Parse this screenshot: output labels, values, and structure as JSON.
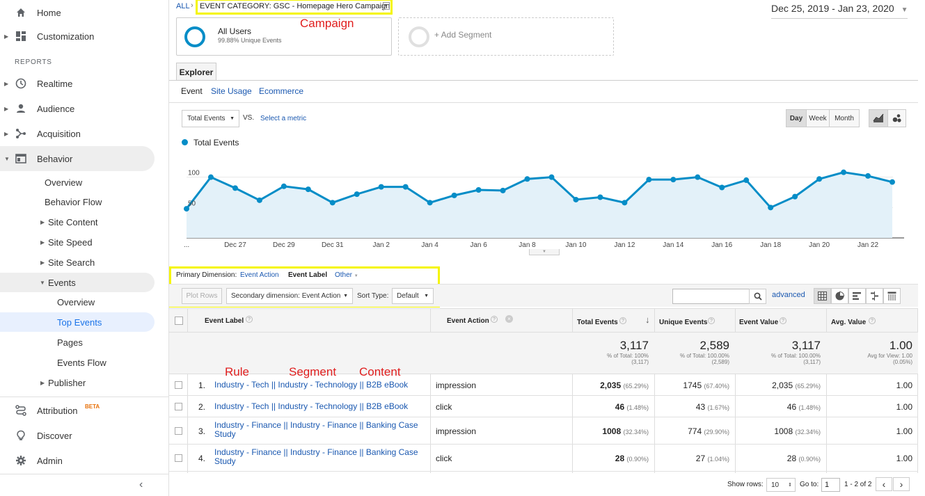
{
  "sidebar": {
    "home": "Home",
    "customization": "Customization",
    "reports_header": "REPORTS",
    "realtime": "Realtime",
    "audience": "Audience",
    "acquisition": "Acquisition",
    "behavior": "Behavior",
    "behavior_sub": [
      "Overview",
      "Behavior Flow",
      "Site Content",
      "Site Speed",
      "Site Search",
      "Events"
    ],
    "events_sub": [
      "Overview",
      "Top Events",
      "Pages",
      "Events Flow"
    ],
    "publisher": "Publisher",
    "attribution": "Attribution",
    "attribution_badge": "BETA",
    "discover": "Discover",
    "admin": "Admin"
  },
  "header": {
    "all": "ALL",
    "breadcrumb_sep": "›",
    "event_category": "EVENT CATEGORY: GSC - Homepage Hero Campaign",
    "date_range": "Dec 25, 2019 - Jan 23, 2020"
  },
  "annotations": {
    "campaign": "Campaign",
    "rule": "Rule",
    "segment": "Segment",
    "content": "Content"
  },
  "segments": {
    "all_users": "All Users",
    "unique_events": "99.88% Unique Events",
    "add_segment": "+ Add Segment"
  },
  "tabs": {
    "explorer": "Explorer",
    "sub": [
      "Event",
      "Site Usage",
      "Ecommerce"
    ]
  },
  "chart_controls": {
    "metric": "Total Events",
    "vs": "VS.",
    "select_metric": "Select a metric",
    "day": "Day",
    "week": "Week",
    "month": "Month"
  },
  "chart_data": {
    "type": "line",
    "series": [
      {
        "name": "Total Events",
        "values": [
          48,
          100,
          82,
          62,
          85,
          80,
          58,
          72,
          84,
          84,
          58,
          70,
          79,
          78,
          97,
          100,
          63,
          67,
          58,
          96,
          96,
          100,
          83,
          95,
          50,
          68,
          97,
          108,
          102,
          92
        ]
      }
    ],
    "x_tick_labels": [
      "...",
      "Dec 27",
      "Dec 29",
      "Dec 31",
      "Jan 2",
      "Jan 4",
      "Jan 6",
      "Jan 8",
      "Jan 10",
      "Jan 12",
      "Jan 14",
      "Jan 16",
      "Jan 18",
      "Jan 20",
      "Jan 22"
    ],
    "y_ticks": [
      "150",
      "100",
      "50"
    ],
    "ylim": [
      0,
      150
    ],
    "color": "#058dc7",
    "fill": "#e3f1f9"
  },
  "dimension": {
    "primary_label": "Primary Dimension:",
    "event_action": "Event Action",
    "event_label": "Event Label",
    "other": "Other",
    "plot_rows": "Plot Rows",
    "secondary": "Secondary dimension: Event Action",
    "sort_type_label": "Sort Type:",
    "sort_type": "Default",
    "advanced": "advanced"
  },
  "table": {
    "headers": [
      "Event Label",
      "Event Action",
      "Total Events",
      "Unique Events",
      "Event Value",
      "Avg. Value"
    ],
    "totals": {
      "total_events": "3,117",
      "total_events_sub1": "% of Total: 100%",
      "total_events_sub2": "(3,117)",
      "unique_events": "2,589",
      "unique_events_sub1": "% of Total: 100.00%",
      "unique_events_sub2": "(2,589)",
      "event_value": "3,117",
      "event_value_sub1": "% of Total: 100.00%",
      "event_value_sub2": "(3,117)",
      "avg_value": "1.00",
      "avg_value_sub1": "Avg for View: 1.00",
      "avg_value_sub2": "(0.05%)"
    },
    "rows": [
      {
        "num": "1.",
        "label": "Industry - Tech || Industry - Technology || B2B eBook",
        "action": "impression",
        "total": "2,035",
        "total_pct": "(65.29%)",
        "unique": "1745",
        "unique_pct": "(67.40%)",
        "value": "2,035",
        "value_pct": "(65.29%)",
        "avg": "1.00"
      },
      {
        "num": "2.",
        "label": "Industry - Tech || Industry - Technology || B2B eBook",
        "action": "click",
        "total": "46",
        "total_pct": "(1.48%)",
        "unique": "43",
        "unique_pct": "(1.67%)",
        "value": "46",
        "value_pct": "(1.48%)",
        "avg": "1.00"
      },
      {
        "num": "3.",
        "label": "Industry - Finance || Industry - Finance || Banking Case Study",
        "action": "impression",
        "total": "1008",
        "total_pct": "(32.34%)",
        "unique": "774",
        "unique_pct": "(29.90%)",
        "value": "1008",
        "value_pct": "(32.34%)",
        "avg": "1.00"
      },
      {
        "num": "4.",
        "label": "Industry - Finance || Industry - Finance || Banking Case Study",
        "action": "click",
        "total": "28",
        "total_pct": "(0.90%)",
        "unique": "27",
        "unique_pct": "(1.04%)",
        "value": "28",
        "value_pct": "(0.90%)",
        "avg": "1.00"
      }
    ]
  },
  "pagination": {
    "show_rows": "Show rows:",
    "rows_value": "10",
    "go_to": "Go to:",
    "page_value": "1",
    "range": "1 - 2 of 2"
  }
}
